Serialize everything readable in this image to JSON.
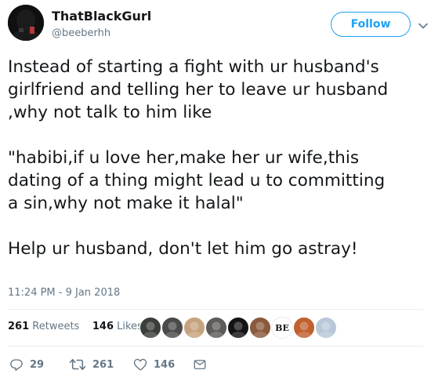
{
  "user": {
    "display_name": "ThatBlackGurl",
    "handle": "@beeberhh"
  },
  "follow_button": {
    "label": "Follow"
  },
  "tweet": {
    "lines_paragraph_1": [
      "Instead of starting a fight with ur husband's",
      "girlfriend and telling her to leave ur husband",
      ",why not talk to him like"
    ],
    "lines_paragraph_2": [
      "\"habibi,if u love her,make her ur wife,this",
      "dating of a thing might lead u to committing",
      "a sin,why not make it halal\""
    ],
    "lines_paragraph_3": [
      "Help ur husband, don't let him go astray!"
    ],
    "timestamp": "11:24 PM - 9 Jan 2018"
  },
  "stats": {
    "retweets_count": "261",
    "retweets_label": "Retweets",
    "likes_count": "146",
    "likes_label": "Likes",
    "liker_avatars": [
      {
        "name": "liker-avatar-1",
        "color": "#3a3f3a"
      },
      {
        "name": "liker-avatar-2",
        "color": "#4a4a4a"
      },
      {
        "name": "liker-avatar-3",
        "color": "#c7a27e"
      },
      {
        "name": "liker-avatar-4",
        "color": "#5e5a57"
      },
      {
        "name": "liker-avatar-5",
        "color": "#141414"
      },
      {
        "name": "liker-avatar-6",
        "color": "#8a5a3c"
      },
      {
        "name": "liker-avatar-7",
        "color": "#ffffff",
        "text": "BE"
      },
      {
        "name": "liker-avatar-8",
        "color": "#c0602f"
      },
      {
        "name": "liker-avatar-9",
        "color": "#b8c8d8"
      }
    ]
  },
  "actions": {
    "reply_count": "29",
    "retweet_count": "261",
    "like_count": "146"
  },
  "colors": {
    "accent": "#1da1f2",
    "secondary_text": "#657786",
    "primary_text": "#14171a",
    "divider": "#e6ecf0"
  },
  "icons": [
    "caret-down-icon",
    "reply-icon",
    "retweet-icon",
    "heart-icon",
    "dm-icon"
  ]
}
